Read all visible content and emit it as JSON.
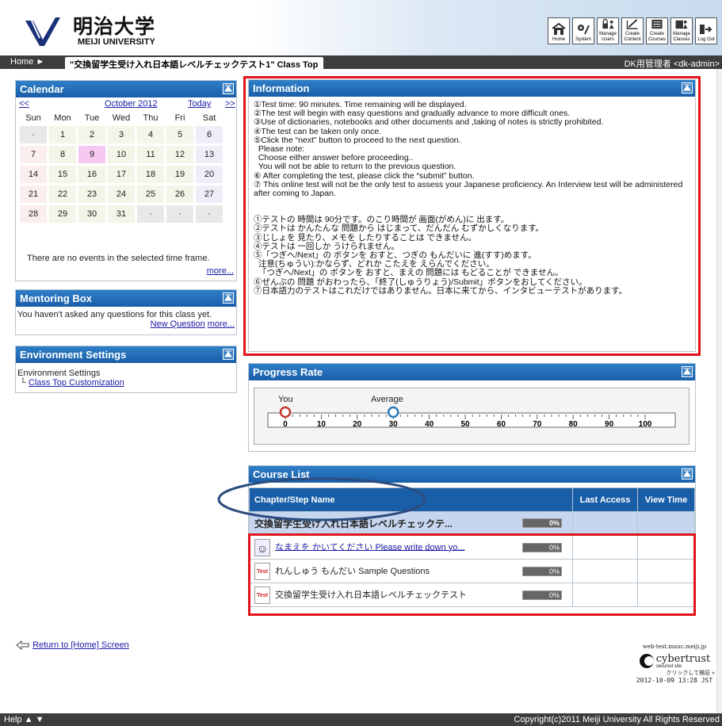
{
  "header": {
    "university_jp": "明治大学",
    "university_en": "MEIJI UNIVERSITY",
    "tools": [
      {
        "icon": "home-icon",
        "label": "Home"
      },
      {
        "icon": "system-icon",
        "label": "System"
      },
      {
        "icon": "manage-users-icon",
        "label": "Manage Users"
      },
      {
        "icon": "create-content-icon",
        "label": "Create Content"
      },
      {
        "icon": "create-courses-icon",
        "label": "Create Courses"
      },
      {
        "icon": "manage-classes-icon",
        "label": "Manage Classes"
      },
      {
        "icon": "logout-icon",
        "label": "Log Out"
      }
    ]
  },
  "nav": {
    "home": "Home",
    "crumb": "\"交換留学生受け入れ日本語レベルチェックテスト1\" Class Top",
    "user": "DK用管理者 <dk-admin>"
  },
  "calendar": {
    "title": "Calendar",
    "prev": "<<",
    "month": "October 2012",
    "today": "Today",
    "next": ">>",
    "weekdays": [
      "Sun",
      "Mon",
      "Tue",
      "Wed",
      "Thu",
      "Fri",
      "Sat"
    ],
    "weeks": [
      [
        "·",
        "1",
        "2",
        "3",
        "4",
        "5",
        "6"
      ],
      [
        "7",
        "8",
        "9",
        "10",
        "11",
        "12",
        "13"
      ],
      [
        "14",
        "15",
        "16",
        "17",
        "18",
        "19",
        "20"
      ],
      [
        "21",
        "22",
        "23",
        "24",
        "25",
        "26",
        "27"
      ],
      [
        "28",
        "29",
        "30",
        "31",
        "·",
        "·",
        "·"
      ]
    ],
    "empty_msg": "There are no events in the selected time frame.",
    "more": "more..."
  },
  "mentoring": {
    "title": "Mentoring Box",
    "msg": "You haven't asked any questions for this class yet.",
    "new_question": "New Question",
    "more": "more..."
  },
  "environment": {
    "title": "Environment Settings",
    "label": "Environment Settings",
    "link": "Class Top Customization"
  },
  "information": {
    "title": "Information",
    "lines_en": [
      "①Test time: 90 minutes. Time remaining will be displayed.",
      "②The test will begin with easy questions and gradually advance to more difficult ones.",
      "③Use of dictionaries, notebooks and other documents and ,taking of notes is strictly prohibited.",
      "④The test can be taken only once.",
      "⑤Click the “next” button to proceed to the next question.",
      "  Please note:",
      "  Choose either answer before proceeding..",
      "  You will not be able to return to the previous question.",
      "⑥ After completing the test, please click the “submit” button.",
      "⑦ This online test will not be the only test to assess your Japanese proficiency. An Interview test will be administered after coming to Japan."
    ],
    "lines_jp": [
      "①テストの 時間は 90分です。のこり時間が 画面(がめん)に 出ます。",
      "②テストは かんたんな 問題から はじまって、だんだん むずかしくなります。",
      "③じしょを 見たり、メモを したりすることは できません。",
      "④テストは 一回しか うけられません。",
      "⑤「つぎへ/Next」の ボタンを おすと、つぎの もんだいに 進(すす)めます。",
      "  注意(ちゅうい):かならず、どれか こたえを えらんでください。",
      "  「つぎへ/Next」の ボタンを おすと、まえの 問題には もどることが できません。",
      "⑥ぜんぶの 問題 がおわったら、「終了(しゅうりょう)/Submit」ボタンをおしてください。",
      "⑦日本語力のテストはこれだけではありません。日本に来てから、インタビューテストがあります。"
    ]
  },
  "progress": {
    "title": "Progress Rate",
    "you": "You",
    "average": "Average",
    "you_value": 0,
    "average_value": 30,
    "ticks": [
      "0",
      "10",
      "20",
      "30",
      "40",
      "50",
      "60",
      "70",
      "80",
      "90",
      "100"
    ]
  },
  "course_list": {
    "title": "Course List",
    "headers": [
      "Chapter/Step Name",
      "Last Access",
      "View Time"
    ],
    "group": {
      "name": "交換留学生受け入れ日本語レベルチェックテ...",
      "pct": "0%"
    },
    "rows": [
      {
        "icon": "face-icon",
        "name": "なまえを かいてください Please write down yo...",
        "pct": "0%",
        "link": true
      },
      {
        "icon": "test-icon",
        "name": "れんしゅう もんだい Sample Questions",
        "pct": "0%",
        "link": false
      },
      {
        "icon": "test-icon",
        "name": "交換留学生受け入れ日本語レベルチェックテスト",
        "pct": "0%",
        "link": false
      }
    ]
  },
  "return_link": "Return to [Home] Screen",
  "cert": {
    "host": "web-test.mauc.meiji.jp",
    "brand": "cybertrust",
    "sub": "secured site",
    "verify": "クリックして検証 »",
    "date": "2012-10-09 13:28 JST"
  },
  "footer": {
    "help": "Help ▲ ▼",
    "copyright": "Copyright(c)2011 Meiji University All Rights Reserved"
  },
  "colors": {
    "accent": "#1a5ea8",
    "highlight": "#e0141c",
    "annotation": "#2b4c7e"
  }
}
